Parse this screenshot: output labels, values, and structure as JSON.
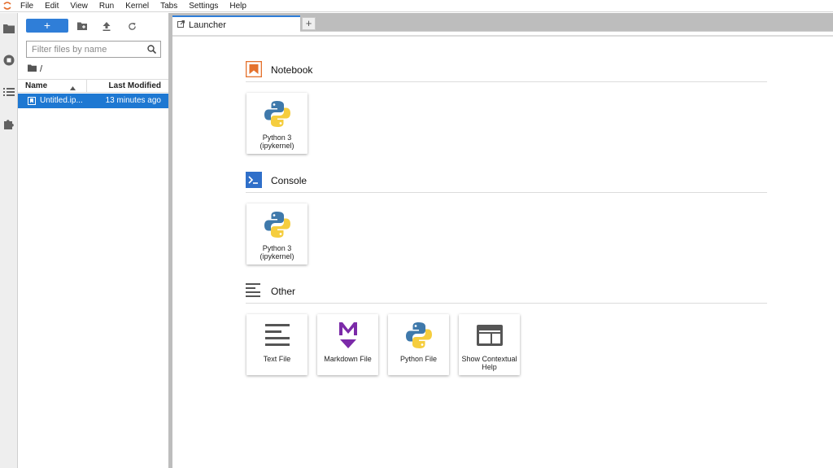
{
  "menubar": {
    "items": [
      "File",
      "Edit",
      "View",
      "Run",
      "Kernel",
      "Tabs",
      "Settings",
      "Help"
    ]
  },
  "filebrowser": {
    "new_label": "+",
    "filter_placeholder": "Filter files by name",
    "breadcrumb": "/",
    "columns": {
      "name": "Name",
      "modified": "Last Modified"
    },
    "files": [
      {
        "name": "Untitled.ipynb",
        "display_name": "Untitled.ip...",
        "modified": "13 minutes ago"
      }
    ]
  },
  "tabs": {
    "active_label": "Launcher",
    "add_label": "+"
  },
  "launcher": {
    "sections": {
      "notebook": {
        "title": "Notebook",
        "cards": [
          {
            "label": "Python 3 (ipykernel)"
          }
        ]
      },
      "console": {
        "title": "Console",
        "cards": [
          {
            "label": "Python 3 (ipykernel)"
          }
        ]
      },
      "other": {
        "title": "Other",
        "cards": [
          {
            "label": "Text File"
          },
          {
            "label": "Markdown File"
          },
          {
            "label": "Python File"
          },
          {
            "label": "Show Contextual Help"
          }
        ]
      }
    }
  },
  "colors": {
    "accent": "#2f7ed8",
    "selection": "#1e78d2",
    "notebook_orange": "#e5722d",
    "markdown_purple": "#7b2aa8",
    "python_blue": "#3f79ab",
    "python_yellow": "#f5cd3e"
  }
}
